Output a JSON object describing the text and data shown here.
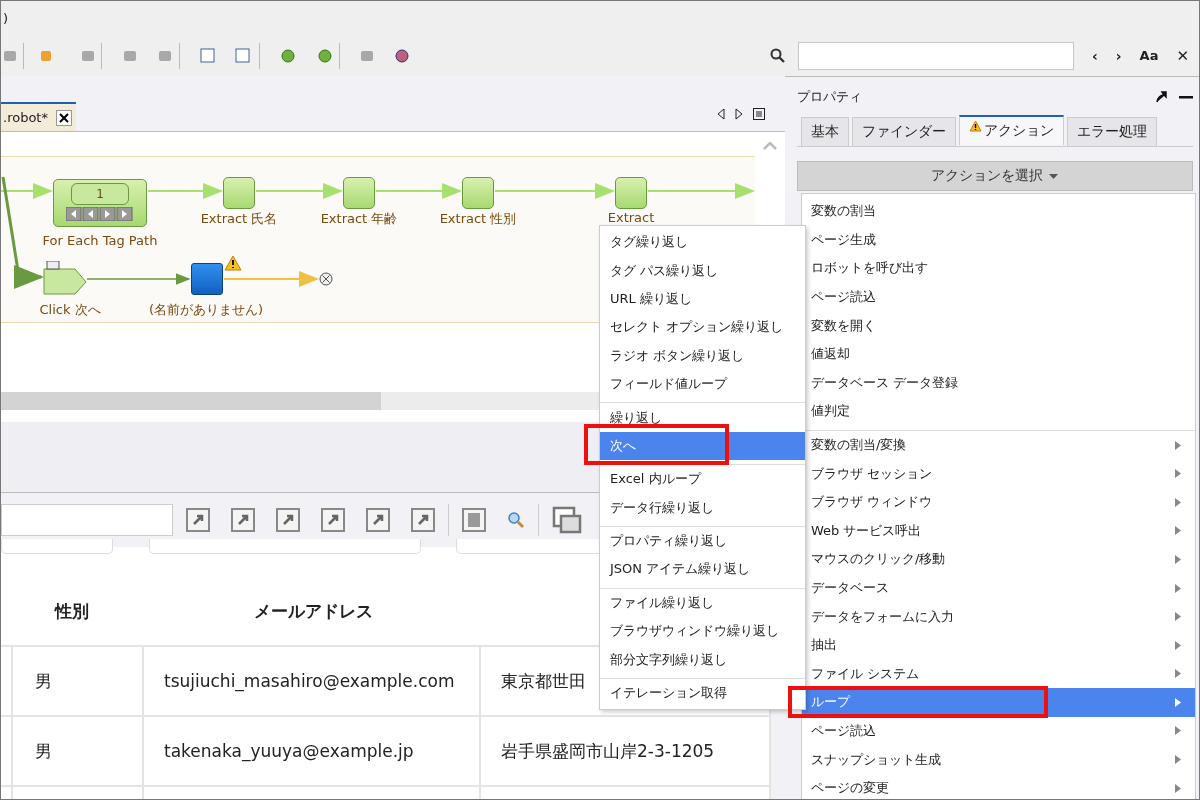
{
  "menubar": {
    "text": ")"
  },
  "find_bar": {
    "buttons": [
      {
        "kind": "prev",
        "label": "‹"
      },
      {
        "kind": "next",
        "label": "›"
      },
      {
        "kind": "case",
        "label": "Aa"
      },
      {
        "kind": "close",
        "label": "✕"
      }
    ]
  },
  "editor_tab": {
    "label": ".robot*",
    "selected": true
  },
  "flow": {
    "main": [
      {
        "kind": "loop",
        "label": "For Each Tag Path",
        "counter": "1"
      },
      {
        "kind": "step",
        "label": "Extract 氏名"
      },
      {
        "kind": "step",
        "label": "Extract 年齢"
      },
      {
        "kind": "step",
        "label": "Extract 性別"
      },
      {
        "kind": "step",
        "label": "Extract"
      }
    ],
    "branch": [
      {
        "kind": "click",
        "label": "Click 次へ"
      },
      {
        "kind": "action",
        "label": "(名前がありません)",
        "warning": true
      },
      {
        "kind": "end"
      }
    ]
  },
  "table": {
    "columns": [
      "性別",
      "メールアドレス"
    ],
    "rows": [
      [
        "男",
        "tsujiuchi_masahiro@example.com",
        "東京都世田"
      ],
      [
        "男",
        "takenaka_yuuya@example.jp",
        "岩手県盛岡市山岸2-3-1205"
      ]
    ]
  },
  "properties": {
    "title": "プロパティ",
    "tabs": [
      {
        "label": "基本",
        "selected": false,
        "warning": false
      },
      {
        "label": "ファインダー",
        "selected": false,
        "warning": false
      },
      {
        "label": "アクション",
        "selected": true,
        "warning": true
      },
      {
        "label": "エラー処理",
        "selected": false,
        "warning": false
      }
    ],
    "action_button": "アクションを選択"
  },
  "action_menu": {
    "items": [
      {
        "label": "変数の割当",
        "submenu": false,
        "selected": false,
        "separator_before": false
      },
      {
        "label": "ページ生成",
        "submenu": false,
        "selected": false,
        "separator_before": false
      },
      {
        "label": "ロボットを呼び出す",
        "submenu": false,
        "selected": false,
        "separator_before": false
      },
      {
        "label": "ページ読込",
        "submenu": false,
        "selected": false,
        "separator_before": false
      },
      {
        "label": "変数を開く",
        "submenu": false,
        "selected": false,
        "separator_before": false
      },
      {
        "label": "値返却",
        "submenu": false,
        "selected": false,
        "separator_before": false
      },
      {
        "label": "データベース データ登録",
        "submenu": false,
        "selected": false,
        "separator_before": false
      },
      {
        "label": "値判定",
        "submenu": false,
        "selected": false,
        "separator_before": false
      },
      {
        "label": "変数の割当/変換",
        "submenu": true,
        "selected": false,
        "separator_before": true
      },
      {
        "label": "ブラウザ セッション",
        "submenu": true,
        "selected": false,
        "separator_before": false
      },
      {
        "label": "ブラウザ ウィンドウ",
        "submenu": true,
        "selected": false,
        "separator_before": false
      },
      {
        "label": "Web サービス呼出",
        "submenu": true,
        "selected": false,
        "separator_before": false
      },
      {
        "label": "マウスのクリック/移動",
        "submenu": true,
        "selected": false,
        "separator_before": false
      },
      {
        "label": "データベース",
        "submenu": true,
        "selected": false,
        "separator_before": false
      },
      {
        "label": "データをフォームに入力",
        "submenu": true,
        "selected": false,
        "separator_before": false
      },
      {
        "label": "抽出",
        "submenu": true,
        "selected": false,
        "separator_before": false
      },
      {
        "label": "ファイル システム",
        "submenu": true,
        "selected": false,
        "separator_before": false
      },
      {
        "label": "ループ",
        "submenu": true,
        "selected": true,
        "separator_before": false
      },
      {
        "label": "ページ読込",
        "submenu": true,
        "selected": false,
        "separator_before": false
      },
      {
        "label": "スナップショット生成",
        "submenu": true,
        "selected": false,
        "separator_before": false
      },
      {
        "label": "ページの変更",
        "submenu": true,
        "selected": false,
        "separator_before": false
      }
    ]
  },
  "loop_submenu": {
    "items": [
      {
        "label": "タグ繰り返し",
        "selected": false,
        "separator_before": false
      },
      {
        "label": "タグ パス繰り返し",
        "selected": false,
        "separator_before": false
      },
      {
        "label": "URL 繰り返し",
        "selected": false,
        "separator_before": false
      },
      {
        "label": "セレクト オプション繰り返し",
        "selected": false,
        "separator_before": false
      },
      {
        "label": "ラジオ ボタン繰り返し",
        "selected": false,
        "separator_before": false
      },
      {
        "label": "フィールド値ループ",
        "selected": false,
        "separator_before": false
      },
      {
        "label": "繰り返し",
        "selected": false,
        "separator_before": true
      },
      {
        "label": "次へ",
        "selected": true,
        "separator_before": false
      },
      {
        "label": "Excel 内ループ",
        "selected": false,
        "separator_before": true
      },
      {
        "label": "データ行繰り返し",
        "selected": false,
        "separator_before": false
      },
      {
        "label": "プロパティ繰り返し",
        "selected": false,
        "separator_before": true
      },
      {
        "label": "JSON アイテム繰り返し",
        "selected": false,
        "separator_before": false
      },
      {
        "label": "ファイル繰り返し",
        "selected": false,
        "separator_before": true
      },
      {
        "label": "ブラウザウィンドウ繰り返し",
        "selected": false,
        "separator_before": false
      },
      {
        "label": "部分文字列繰り返し",
        "selected": false,
        "separator_before": false
      },
      {
        "label": "イテレーション取得",
        "selected": false,
        "separator_before": true
      }
    ]
  }
}
